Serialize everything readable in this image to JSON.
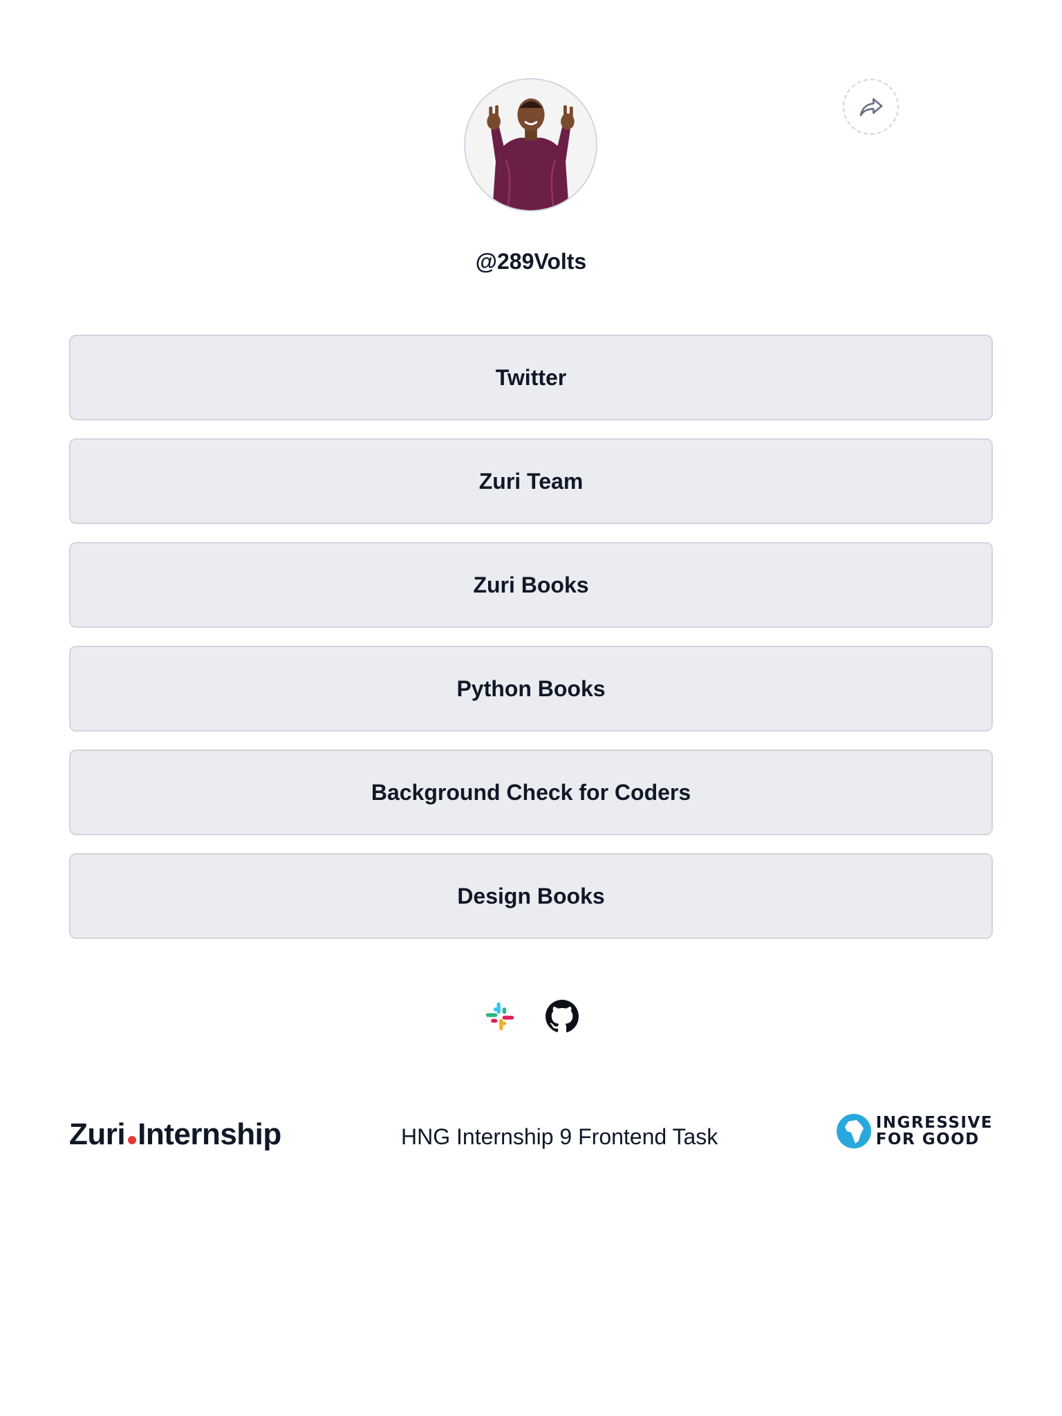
{
  "profile": {
    "username": "@289Volts"
  },
  "links": [
    {
      "label": "Twitter"
    },
    {
      "label": "Zuri Team"
    },
    {
      "label": "Zuri Books"
    },
    {
      "label": "Python Books"
    },
    {
      "label": "Background Check for Coders"
    },
    {
      "label": "Design Books"
    }
  ],
  "social": {
    "icons": [
      "slack-icon",
      "github-icon"
    ]
  },
  "footer": {
    "zuri_brand_left": "Zuri",
    "zuri_brand_right": "Internship",
    "tagline": "HNG Internship 9 Frontend Task",
    "i4g_line1": "INGRESSIVE",
    "i4g_line2": "FOR GOOD"
  },
  "colors": {
    "button_bg": "#eaecf0",
    "button_border": "#d0d5dd",
    "text": "#101828",
    "zuri_dot": "#e53935"
  }
}
